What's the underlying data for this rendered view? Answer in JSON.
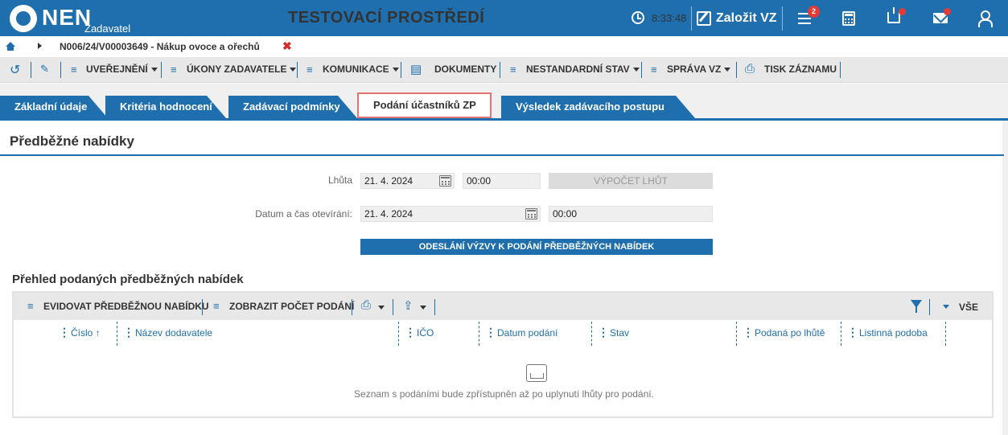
{
  "header": {
    "logo_text": "NEN",
    "logo_sub": "Zadavatel",
    "env_title": "TESTOVACÍ PROSTŘEDÍ",
    "time": "8:33:48",
    "create_label": "Založit VZ",
    "menu_badge": "2"
  },
  "breadcrumb": {
    "text": "N006/24/V00003649 - Nákup ovoce a ořechů",
    "close": "✖"
  },
  "toolbar": {
    "publish": "UVEŘEJNĚNÍ",
    "acts": "ÚKONY ZADAVATELE",
    "comm": "KOMUNIKACE",
    "docs": "DOKUMENTY",
    "nonstandard": "NESTANDARDNÍ STAV",
    "manage": "SPRÁVA VZ",
    "print": "TISK ZÁZNAMU"
  },
  "tabs": [
    {
      "label": "Základní údaje"
    },
    {
      "label": "Kritéria hodnocení"
    },
    {
      "label": "Zadávací podmínky"
    },
    {
      "label": "Podání účastníků ZP"
    },
    {
      "label": "Výsledek zadávacího postupu"
    }
  ],
  "section": {
    "title": "Předběžné nabídky",
    "deadline_label": "Lhůta",
    "deadline_date": "21. 4. 2024",
    "deadline_time": "00:00",
    "calc_button": "VÝPOČET LHŮT",
    "open_label": "Datum a čas otevírání:",
    "open_date": "21. 4. 2024",
    "open_time": "00:00",
    "send_button": "ODESLÁNÍ VÝZVY K PODÁNÍ PŘEDBĚŽNÝCH NABÍDEK"
  },
  "grid": {
    "title": "Přehled podaných předběžných nabídek",
    "evidence": "EVIDOVAT PŘEDBĚŽNOU NABÍDKU",
    "show_count": "ZOBRAZIT POČET PODÁNÍ",
    "all": "VŠE",
    "columns": [
      {
        "label": "Číslo ↑"
      },
      {
        "label": "Název dodavatele"
      },
      {
        "label": "IČO"
      },
      {
        "label": "Datum podání"
      },
      {
        "label": "Stav"
      },
      {
        "label": "Podaná po lhůtě"
      },
      {
        "label": "Listinná podoba"
      }
    ],
    "empty_text": "Seznam s podáními bude zpřístupněn až po uplynutí lhůty pro podání."
  },
  "colors": {
    "primary": "#1f6fae",
    "alert": "#e53935",
    "active_tab_border": "#e57373"
  },
  "icons": [
    "clock-icon",
    "edit-icon",
    "menu-icon",
    "calculator-icon",
    "inbox-icon",
    "mail-icon",
    "user-icon",
    "home-icon",
    "calendar-icon",
    "filter-icon",
    "empty-tray-icon"
  ]
}
